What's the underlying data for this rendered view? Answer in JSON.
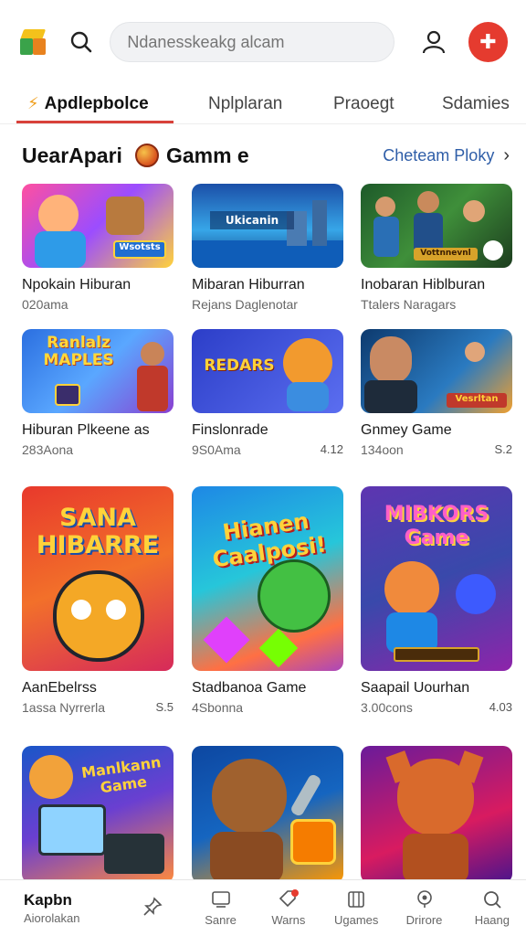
{
  "header": {
    "search_placeholder": "Ndanesskeakg alcam",
    "badge_glyph": "✚"
  },
  "tabs": [
    {
      "label": "Apdlepbolce"
    },
    {
      "label": "Nplplaran"
    },
    {
      "label": "Praoegt"
    },
    {
      "label": "Sdamies"
    }
  ],
  "section": {
    "title_left": "UearApari",
    "title_right": "Gamm e",
    "see_all": "Cheteam Ploky"
  },
  "games": [
    {
      "title": "Npokain Hiburan",
      "sub": "020ama",
      "rating": "",
      "thumb_text": "Wsotsts"
    },
    {
      "title": "Mibaran Hiburran",
      "sub": "Rejans Daglenotar",
      "rating": "",
      "thumb_text": "Ukicanin"
    },
    {
      "title": "Inobaran Hiblburan",
      "sub": "Ttalers Naragars",
      "rating": "",
      "thumb_text": "Vottnnevnl"
    },
    {
      "title": "Hiburan Plkeene as",
      "sub": "283Aona",
      "rating": "",
      "thumb_text": "Ranlalz MAPLES"
    },
    {
      "title": "Finslonrade",
      "sub": "9S0Ama",
      "rating": "4.12",
      "thumb_text": "REDARS"
    },
    {
      "title": "Gnmey Game",
      "sub": "134oon",
      "rating": "S.2",
      "thumb_text": "Vesrltan"
    },
    {
      "title": "AanEbelrss",
      "sub": "1assa Nyrrerla",
      "rating": "S.5",
      "thumb_text": "SANA HIBARRE"
    },
    {
      "title": "Stadbanoa Game",
      "sub": "4Sbonna",
      "rating": "",
      "thumb_text": "Hianen Caalposi!"
    },
    {
      "title": "Saapail Uourhan",
      "sub": "3.00cons",
      "rating": "4.03",
      "thumb_text": "MIBKORS Game"
    },
    {
      "title": "",
      "sub": "",
      "rating": "",
      "thumb_text": "Manlkann Game"
    },
    {
      "title": "",
      "sub": "",
      "rating": "",
      "thumb_text": ""
    },
    {
      "title": "",
      "sub": "",
      "rating": "",
      "thumb_text": ""
    }
  ],
  "bottom_nav": {
    "first_big": "Kapbn",
    "first_small": "Aiorolakan",
    "items": [
      {
        "label": ""
      },
      {
        "label": "Sanre"
      },
      {
        "label": "Warns"
      },
      {
        "label": "Ugames"
      },
      {
        "label": "Drirore"
      },
      {
        "label": "Haang"
      }
    ]
  },
  "colors": {
    "accent": "#d8413a",
    "link": "#2f5ea8",
    "badge": "#e53b2f"
  }
}
